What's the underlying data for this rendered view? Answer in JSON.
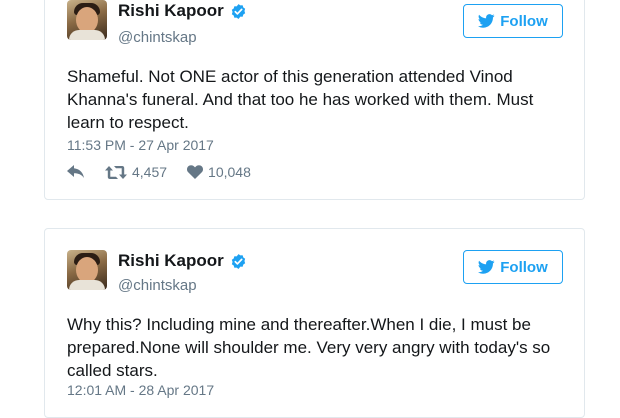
{
  "tweets": [
    {
      "display_name": "Rishi Kapoor",
      "handle": "@chintskap",
      "follow_label": "Follow",
      "text": "Shameful. Not ONE actor of this generation attended Vinod Khanna's funeral. And that too he has worked with them. Must learn to respect.",
      "timestamp": "11:53 PM - 27 Apr 2017",
      "retweets": "4,457",
      "likes": "10,048"
    },
    {
      "display_name": "Rishi Kapoor",
      "handle": "@chintskap",
      "follow_label": "Follow",
      "text": "Why this? Including mine and thereafter.When I die, I must be prepared.None will shoulder me. Very very angry with today's so called stars.",
      "timestamp": "12:01 AM - 28 Apr 2017"
    }
  ],
  "colors": {
    "accent": "#1da1f2",
    "secondary_text": "#657786",
    "border": "#e1e8ed"
  },
  "icons": [
    "verified-badge-icon",
    "twitter-bird-icon",
    "reply-icon",
    "retweet-icon",
    "heart-icon"
  ]
}
